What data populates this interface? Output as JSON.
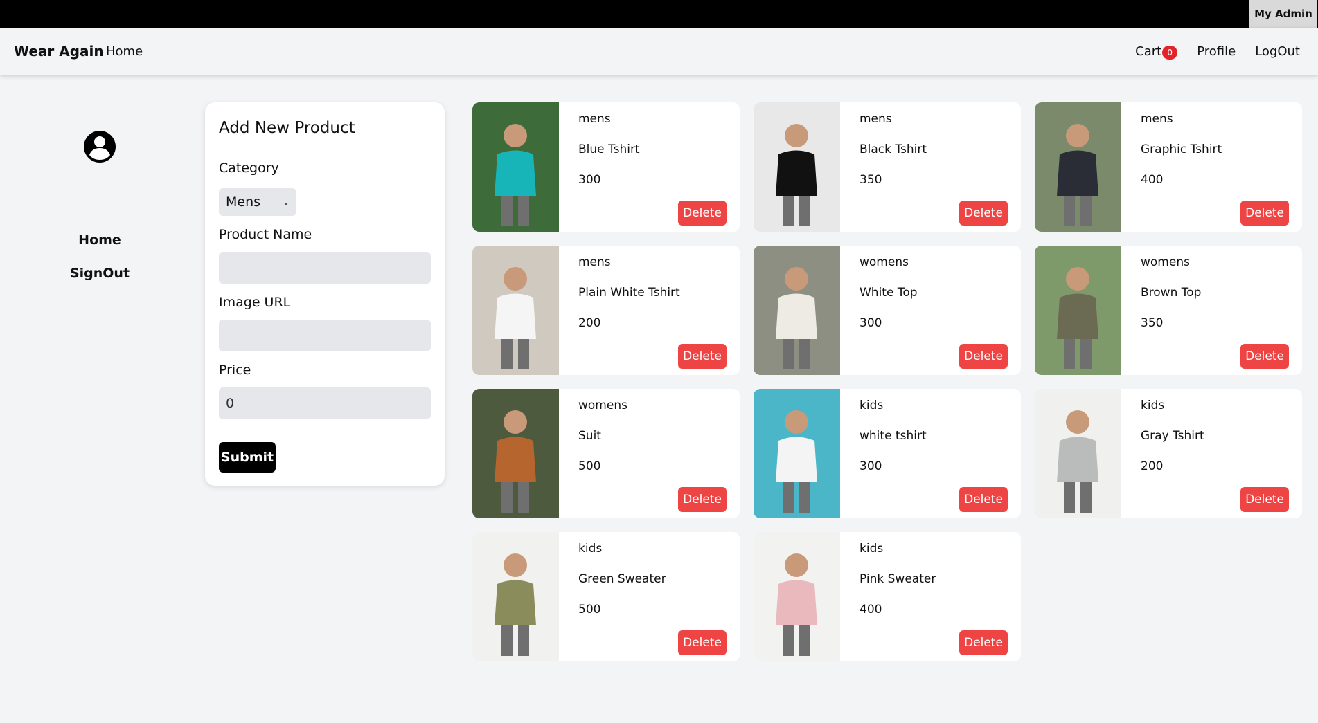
{
  "topbar": {
    "admin_label": "My Admin"
  },
  "navbar": {
    "brand": "Wear Again",
    "home": "Home",
    "cart": "Cart",
    "cart_count": "0",
    "profile": "Profile",
    "logout": "LogOut"
  },
  "sidebar": {
    "icon": "user-circle-icon",
    "home": "Home",
    "signout": "SignOut"
  },
  "form": {
    "title": "Add New Product",
    "category_label": "Category",
    "category_value": "Mens",
    "product_name_label": "Product Name",
    "product_name_value": "",
    "image_url_label": "Image URL",
    "image_url_value": "",
    "price_label": "Price",
    "price_value": "0",
    "submit": "Submit"
  },
  "products": [
    {
      "category": "mens",
      "name": "Blue Tshirt",
      "price": "300",
      "delete": "Delete",
      "bg": "#3d6b3a",
      "fg": "#18b5b8"
    },
    {
      "category": "mens",
      "name": "Black Tshirt",
      "price": "350",
      "delete": "Delete",
      "bg": "#e8e8e8",
      "fg": "#111111"
    },
    {
      "category": "mens",
      "name": "Graphic Tshirt",
      "price": "400",
      "delete": "Delete",
      "bg": "#7a8a6a",
      "fg": "#2a2d35"
    },
    {
      "category": "mens",
      "name": "Plain White Tshirt",
      "price": "200",
      "delete": "Delete",
      "bg": "#cfc9bf",
      "fg": "#f5f5f5"
    },
    {
      "category": "womens",
      "name": "White Top",
      "price": "300",
      "delete": "Delete",
      "bg": "#8d8f82",
      "fg": "#eeeae4"
    },
    {
      "category": "womens",
      "name": "Brown Top",
      "price": "350",
      "delete": "Delete",
      "bg": "#7f9a6a",
      "fg": "#6b6a52"
    },
    {
      "category": "womens",
      "name": "Suit",
      "price": "500",
      "delete": "Delete",
      "bg": "#4d5a3e",
      "fg": "#b5652d"
    },
    {
      "category": "kids",
      "name": "white tshirt",
      "price": "300",
      "delete": "Delete",
      "bg": "#4ab6c7",
      "fg": "#f4f4f4"
    },
    {
      "category": "kids",
      "name": "Gray Tshirt",
      "price": "200",
      "delete": "Delete",
      "bg": "#f0f0ee",
      "fg": "#b9bcba"
    },
    {
      "category": "kids",
      "name": "Green Sweater",
      "price": "500",
      "delete": "Delete",
      "bg": "#f1f1ef",
      "fg": "#8a8c5c"
    },
    {
      "category": "kids",
      "name": "Pink Sweater",
      "price": "400",
      "delete": "Delete",
      "bg": "#f2f2f0",
      "fg": "#e9b9bd"
    }
  ],
  "colors": {
    "accent": "#ef4444",
    "badge": "#e3222a"
  }
}
